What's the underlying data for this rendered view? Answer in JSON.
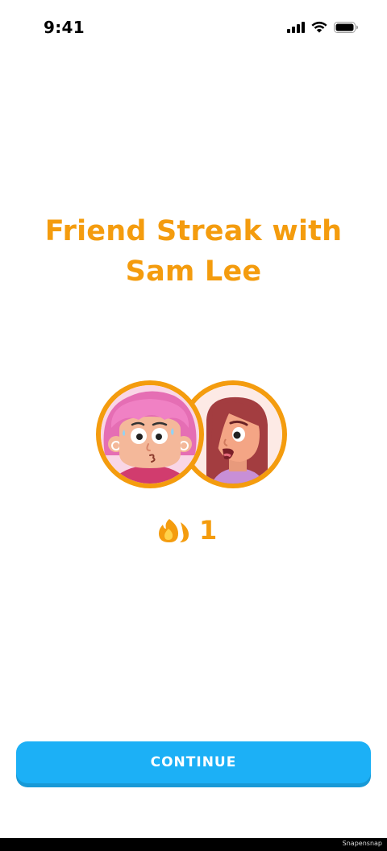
{
  "status_bar": {
    "time": "9:41",
    "icons": [
      "cellular-signal-icon",
      "wifi-icon",
      "battery-icon"
    ]
  },
  "title": {
    "line1": "Friend Streak with",
    "line2": "Sam Lee"
  },
  "avatars": [
    {
      "name": "user-avatar",
      "ring_color": "#F49C0E"
    },
    {
      "name": "friend-avatar",
      "ring_color": "#F49C0E"
    }
  ],
  "streak": {
    "icon": "friend-streak-flame-icon",
    "count": "1"
  },
  "continue_button": {
    "label": "CONTINUE"
  },
  "watermark": "Snapensnap",
  "colors": {
    "accent": "#F49C0E",
    "button": "#1CB0F6",
    "button_shadow": "#1899D6"
  }
}
